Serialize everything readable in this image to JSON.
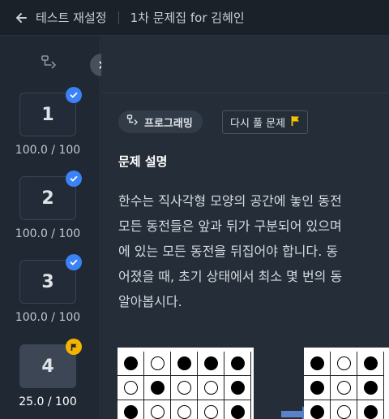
{
  "header": {
    "back_label": "테스트 재설정",
    "set_title": "1차 문제집 for 김혜인"
  },
  "sidebar": {
    "items": [
      {
        "number": "1",
        "score": "100.0 / 100",
        "status": "check"
      },
      {
        "number": "2",
        "score": "100.0 / 100",
        "status": "check"
      },
      {
        "number": "3",
        "score": "100.0 / 100",
        "status": "check"
      },
      {
        "number": "4",
        "score": "25.0 / 100",
        "status": "flag"
      }
    ]
  },
  "main": {
    "tag_label": "프로그래밍",
    "retry_label": "다시 풀 문제",
    "section_title": "문제 설명",
    "description_lines": [
      "한수는 직사각형 모양의 공간에 놓인 동전",
      "모든 동전들은 앞과 뒤가 구분되어 있으며",
      "에 있는 모든 동전을 뒤집어야 합니다. 동",
      "어졌을 때, 초기 상태에서 최소 몇 번의 동",
      "알아봅시다."
    ],
    "figure": {
      "left_grid": [
        [
          "black",
          "white",
          "black",
          "black",
          "black"
        ],
        [
          "white",
          "black",
          "white",
          "white",
          "black"
        ],
        [
          "black",
          "white",
          "white",
          "white",
          "black"
        ]
      ],
      "right_grid": [
        [
          "black",
          "white",
          "black"
        ],
        [
          "black",
          "white",
          "black"
        ],
        [
          "black",
          "white",
          "black"
        ]
      ]
    }
  },
  "colors": {
    "check_badge": "#3b82f6",
    "flag_badge": "#f5b400",
    "flag_icon": "#f5c400"
  }
}
